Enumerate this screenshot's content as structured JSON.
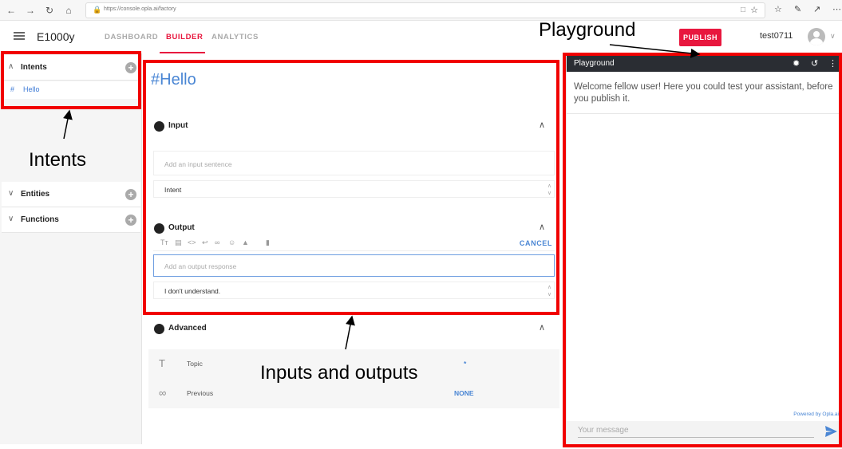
{
  "browser": {
    "url": "https://console.opla.ai/factory",
    "nav_icons": [
      "back-icon",
      "forward-icon",
      "refresh-icon",
      "home-icon"
    ],
    "toolbar_icons": [
      "reading-view-icon",
      "favorite-star-icon",
      "favorites-list-icon",
      "pen-icon",
      "share-icon",
      "more-icon"
    ]
  },
  "header": {
    "project": "E1000y",
    "tabs": [
      {
        "label": "DASHBOARD",
        "active": false
      },
      {
        "label": "BUILDER",
        "active": true
      },
      {
        "label": "ANALYTICS",
        "active": false
      }
    ],
    "publish_label": "PUBLISH",
    "username": "test0711",
    "accent_color": "#e8173e"
  },
  "sidebar": {
    "sections": [
      {
        "label": "Intents",
        "expanded": true,
        "items": [
          {
            "label": "Hello"
          }
        ]
      },
      {
        "label": "Entities",
        "expanded": false
      },
      {
        "label": "Functions",
        "expanded": false
      }
    ]
  },
  "editor": {
    "title": "#Hello",
    "input": {
      "heading": "Input",
      "placeholder": "Add an input sentence",
      "value": "Intent"
    },
    "output": {
      "heading": "Output",
      "cancel_label": "CANCEL",
      "placeholder": "Add an output response",
      "value": "I don't understand."
    },
    "advanced": {
      "heading": "Advanced",
      "rows": [
        {
          "key": "Topic",
          "value": "*",
          "icon": "text-icon"
        },
        {
          "key": "Previous",
          "value": "NONE",
          "icon": "link-icon"
        }
      ]
    }
  },
  "playground": {
    "title": "Playground",
    "welcome": "Welcome fellow user! Here you could test your assistant, before you publish it.",
    "powered": "Powered by Opla.ai",
    "message_placeholder": "Your message"
  },
  "annotations": {
    "intents": "Intents",
    "inputs_outputs": "Inputs and outputs",
    "playground": "Playground",
    "box_color": "#f10000"
  }
}
